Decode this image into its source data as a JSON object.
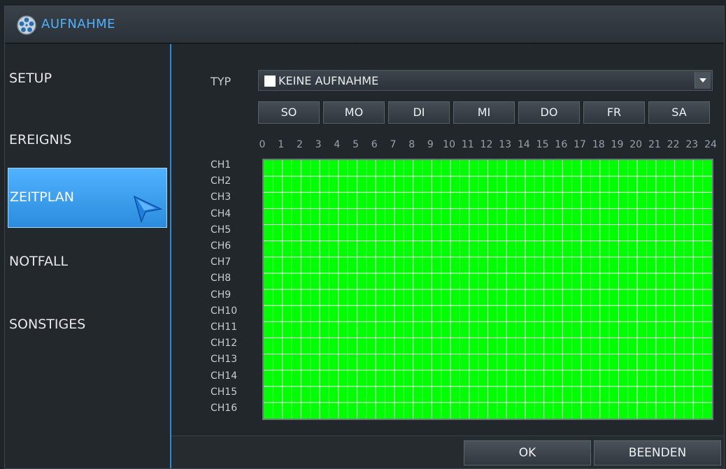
{
  "window": {
    "title": "AUFNAHME",
    "icon": "film-reel-icon"
  },
  "sidebar": {
    "items": [
      {
        "label": "SETUP",
        "active": false
      },
      {
        "label": "EREIGNIS",
        "active": false
      },
      {
        "label": "ZEITPLAN",
        "active": true
      },
      {
        "label": "NOTFALL",
        "active": false
      },
      {
        "label": "SONSTIGES",
        "active": false
      }
    ]
  },
  "schedule": {
    "type_label": "TYP",
    "type_value": "KEINE AUFNAHME",
    "type_swatch_color": "#ffffff",
    "days": [
      "SO",
      "MO",
      "DI",
      "MI",
      "DO",
      "FR",
      "SA"
    ],
    "hours": [
      "0",
      "1",
      "2",
      "3",
      "4",
      "5",
      "6",
      "7",
      "8",
      "9",
      "10",
      "11",
      "12",
      "13",
      "14",
      "15",
      "16",
      "17",
      "18",
      "19",
      "20",
      "21",
      "22",
      "23",
      "24"
    ],
    "channels": [
      "CH1",
      "CH2",
      "CH3",
      "CH4",
      "CH5",
      "CH6",
      "CH7",
      "CH8",
      "CH9",
      "CH10",
      "CH11",
      "CH12",
      "CH13",
      "CH14",
      "CH15",
      "CH16"
    ],
    "grid_fill_color": "#00ff00",
    "grid_line_color": "#ffffff"
  },
  "footer": {
    "ok_label": "OK",
    "exit_label": "BEENDEN"
  },
  "colors": {
    "accent": "#2a8bd9",
    "title_text": "#4fb0ff"
  }
}
